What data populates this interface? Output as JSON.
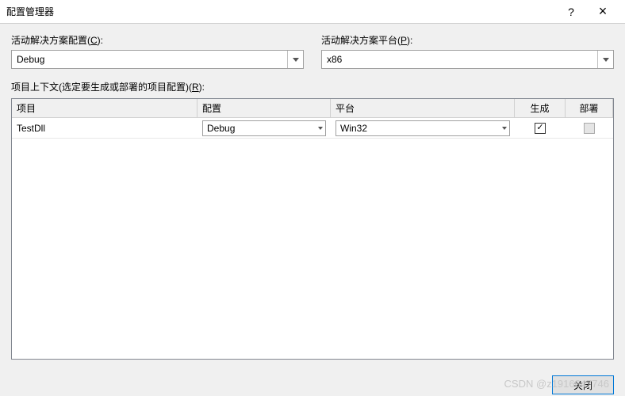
{
  "title": "配置管理器",
  "helpSymbol": "?",
  "closeSymbol": "×",
  "config": {
    "label_prefix": "活动解决方案配置(",
    "label_hotkey": "C",
    "label_suffix": "):",
    "value": "Debug"
  },
  "platform": {
    "label_prefix": "活动解决方案平台(",
    "label_hotkey": "P",
    "label_suffix": "):",
    "value": "x86"
  },
  "context": {
    "label_prefix": "项目上下文(选定要生成或部署的项目配置)(",
    "label_hotkey": "R",
    "label_suffix": "):"
  },
  "columns": {
    "project": "项目",
    "config": "配置",
    "platform": "平台",
    "build": "生成",
    "deploy": "部署"
  },
  "row": {
    "project": "TestDll",
    "config": "Debug",
    "platform": "Win32",
    "buildChecked": true,
    "deployEnabled": false
  },
  "close_btn": "关闭",
  "watermark": "CSDN @z1916647746"
}
